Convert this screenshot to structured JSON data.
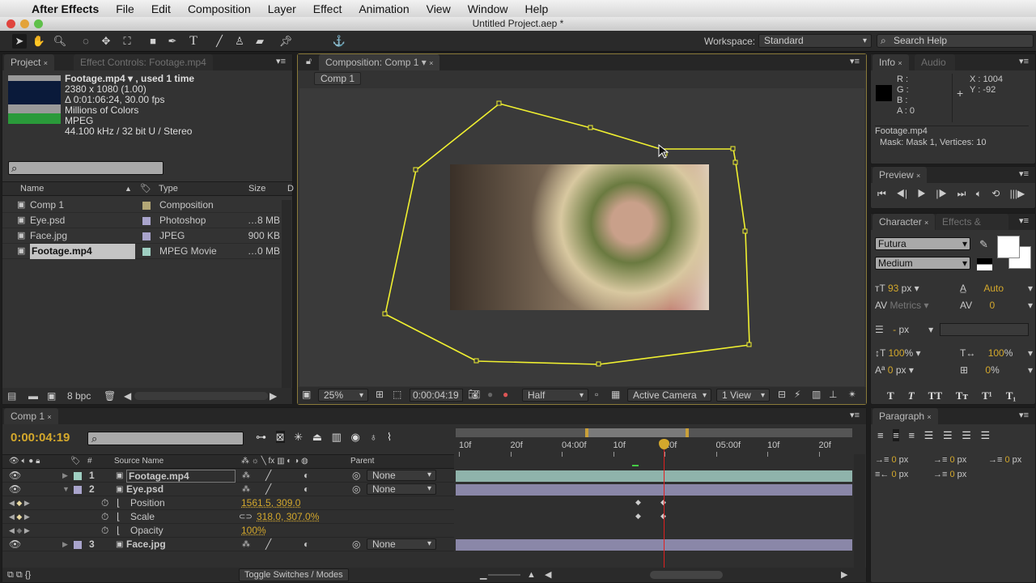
{
  "menubar": {
    "app": "After Effects",
    "items": [
      "File",
      "Edit",
      "Composition",
      "Layer",
      "Effect",
      "Animation",
      "View",
      "Window",
      "Help"
    ]
  },
  "window": {
    "title": "Untitled Project.aep *"
  },
  "toolbar": {
    "workspace_label": "Workspace:",
    "workspace": "Standard",
    "search_placeholder": "Search Help"
  },
  "project": {
    "tab": "Project",
    "tab2": "Effect Controls: Footage.mp4",
    "info": {
      "name": "Footage.mp4 ▾ , used 1 time",
      "dims": "2380 x 1080 (1.00)",
      "duration": "Δ 0:01:06:24, 30.00 fps",
      "colors": "Millions of Colors",
      "codec": "MPEG",
      "audio": "44.100 kHz / 32 bit U / Stereo"
    },
    "columns": {
      "name": "Name",
      "type": "Type",
      "size": "Size",
      "d": "D"
    },
    "items": [
      {
        "name": "Comp 1",
        "type": "Composition",
        "size": "",
        "color": "#b3a777"
      },
      {
        "name": "Eye.psd",
        "type": "Photoshop",
        "size": "…8 MB",
        "color": "#a9a4cc"
      },
      {
        "name": "Face.jpg",
        "type": "JPEG",
        "size": "900 KB",
        "color": "#a9a4cc"
      },
      {
        "name": "Footage.mp4",
        "type": "MPEG Movie",
        "size": "…0 MB",
        "color": "#9fcfc2"
      }
    ],
    "bpc": "8 bpc"
  },
  "composition": {
    "tab": "Composition: Comp 1",
    "breadcrumb": "Comp 1",
    "zoom": "25%",
    "timecode": "0:00:04:19",
    "resolution": "Half",
    "camera": "Active Camera",
    "views": "1 View"
  },
  "info": {
    "tab": "Info",
    "tab2": "Audio",
    "r": "R :",
    "g": "G :",
    "b": "B :",
    "a": "A : 0",
    "x": "X : 1004",
    "y": "Y : -92",
    "layer": "Footage.mp4",
    "mask": "Mask: Mask 1, Vertices: 10"
  },
  "preview": {
    "tab": "Preview"
  },
  "character": {
    "tab": "Character",
    "tab2": "Effects & Prese",
    "font": "Futura",
    "style": "Medium",
    "size": "93",
    "size_unit": "px",
    "leading": "Auto",
    "kerning": "Metrics",
    "tracking": "0",
    "stroke": "-",
    "stroke_unit": "px",
    "vscale": "100",
    "hscale": "100",
    "baseline": "0",
    "baseline_unit": "px",
    "tsume": "0",
    "pct": "%",
    "styles": [
      "T",
      "T",
      "TT",
      "Tт",
      "T¹",
      "T₁"
    ]
  },
  "paragraph": {
    "tab": "Paragraph",
    "values": [
      "0",
      "0",
      "0",
      "0",
      "0"
    ],
    "unit": "px"
  },
  "timeline": {
    "tab": "Comp 1",
    "timecode": "0:00:04:19",
    "cols": {
      "num": "#",
      "source": "Source Name",
      "parent": "Parent"
    },
    "ruler": [
      "10f",
      "20f",
      "04:00f",
      "10f",
      "20f",
      "05:00f",
      "10f",
      "20f"
    ],
    "layers": [
      {
        "num": "1",
        "name": "Footage.mp4",
        "parent": "None",
        "color": "#9fcfc2"
      },
      {
        "num": "2",
        "name": "Eye.psd",
        "parent": "None",
        "color": "#a9a4cc"
      },
      {
        "num": "3",
        "name": "Face.jpg",
        "parent": "None",
        "color": "#a9a4cc"
      }
    ],
    "props": [
      {
        "name": "Position",
        "value": "1561.5, 309.0"
      },
      {
        "name": "Scale",
        "value": "318.0, 307.0%"
      },
      {
        "name": "Opacity",
        "value": "100%"
      }
    ],
    "toggle": "Toggle Switches / Modes"
  }
}
